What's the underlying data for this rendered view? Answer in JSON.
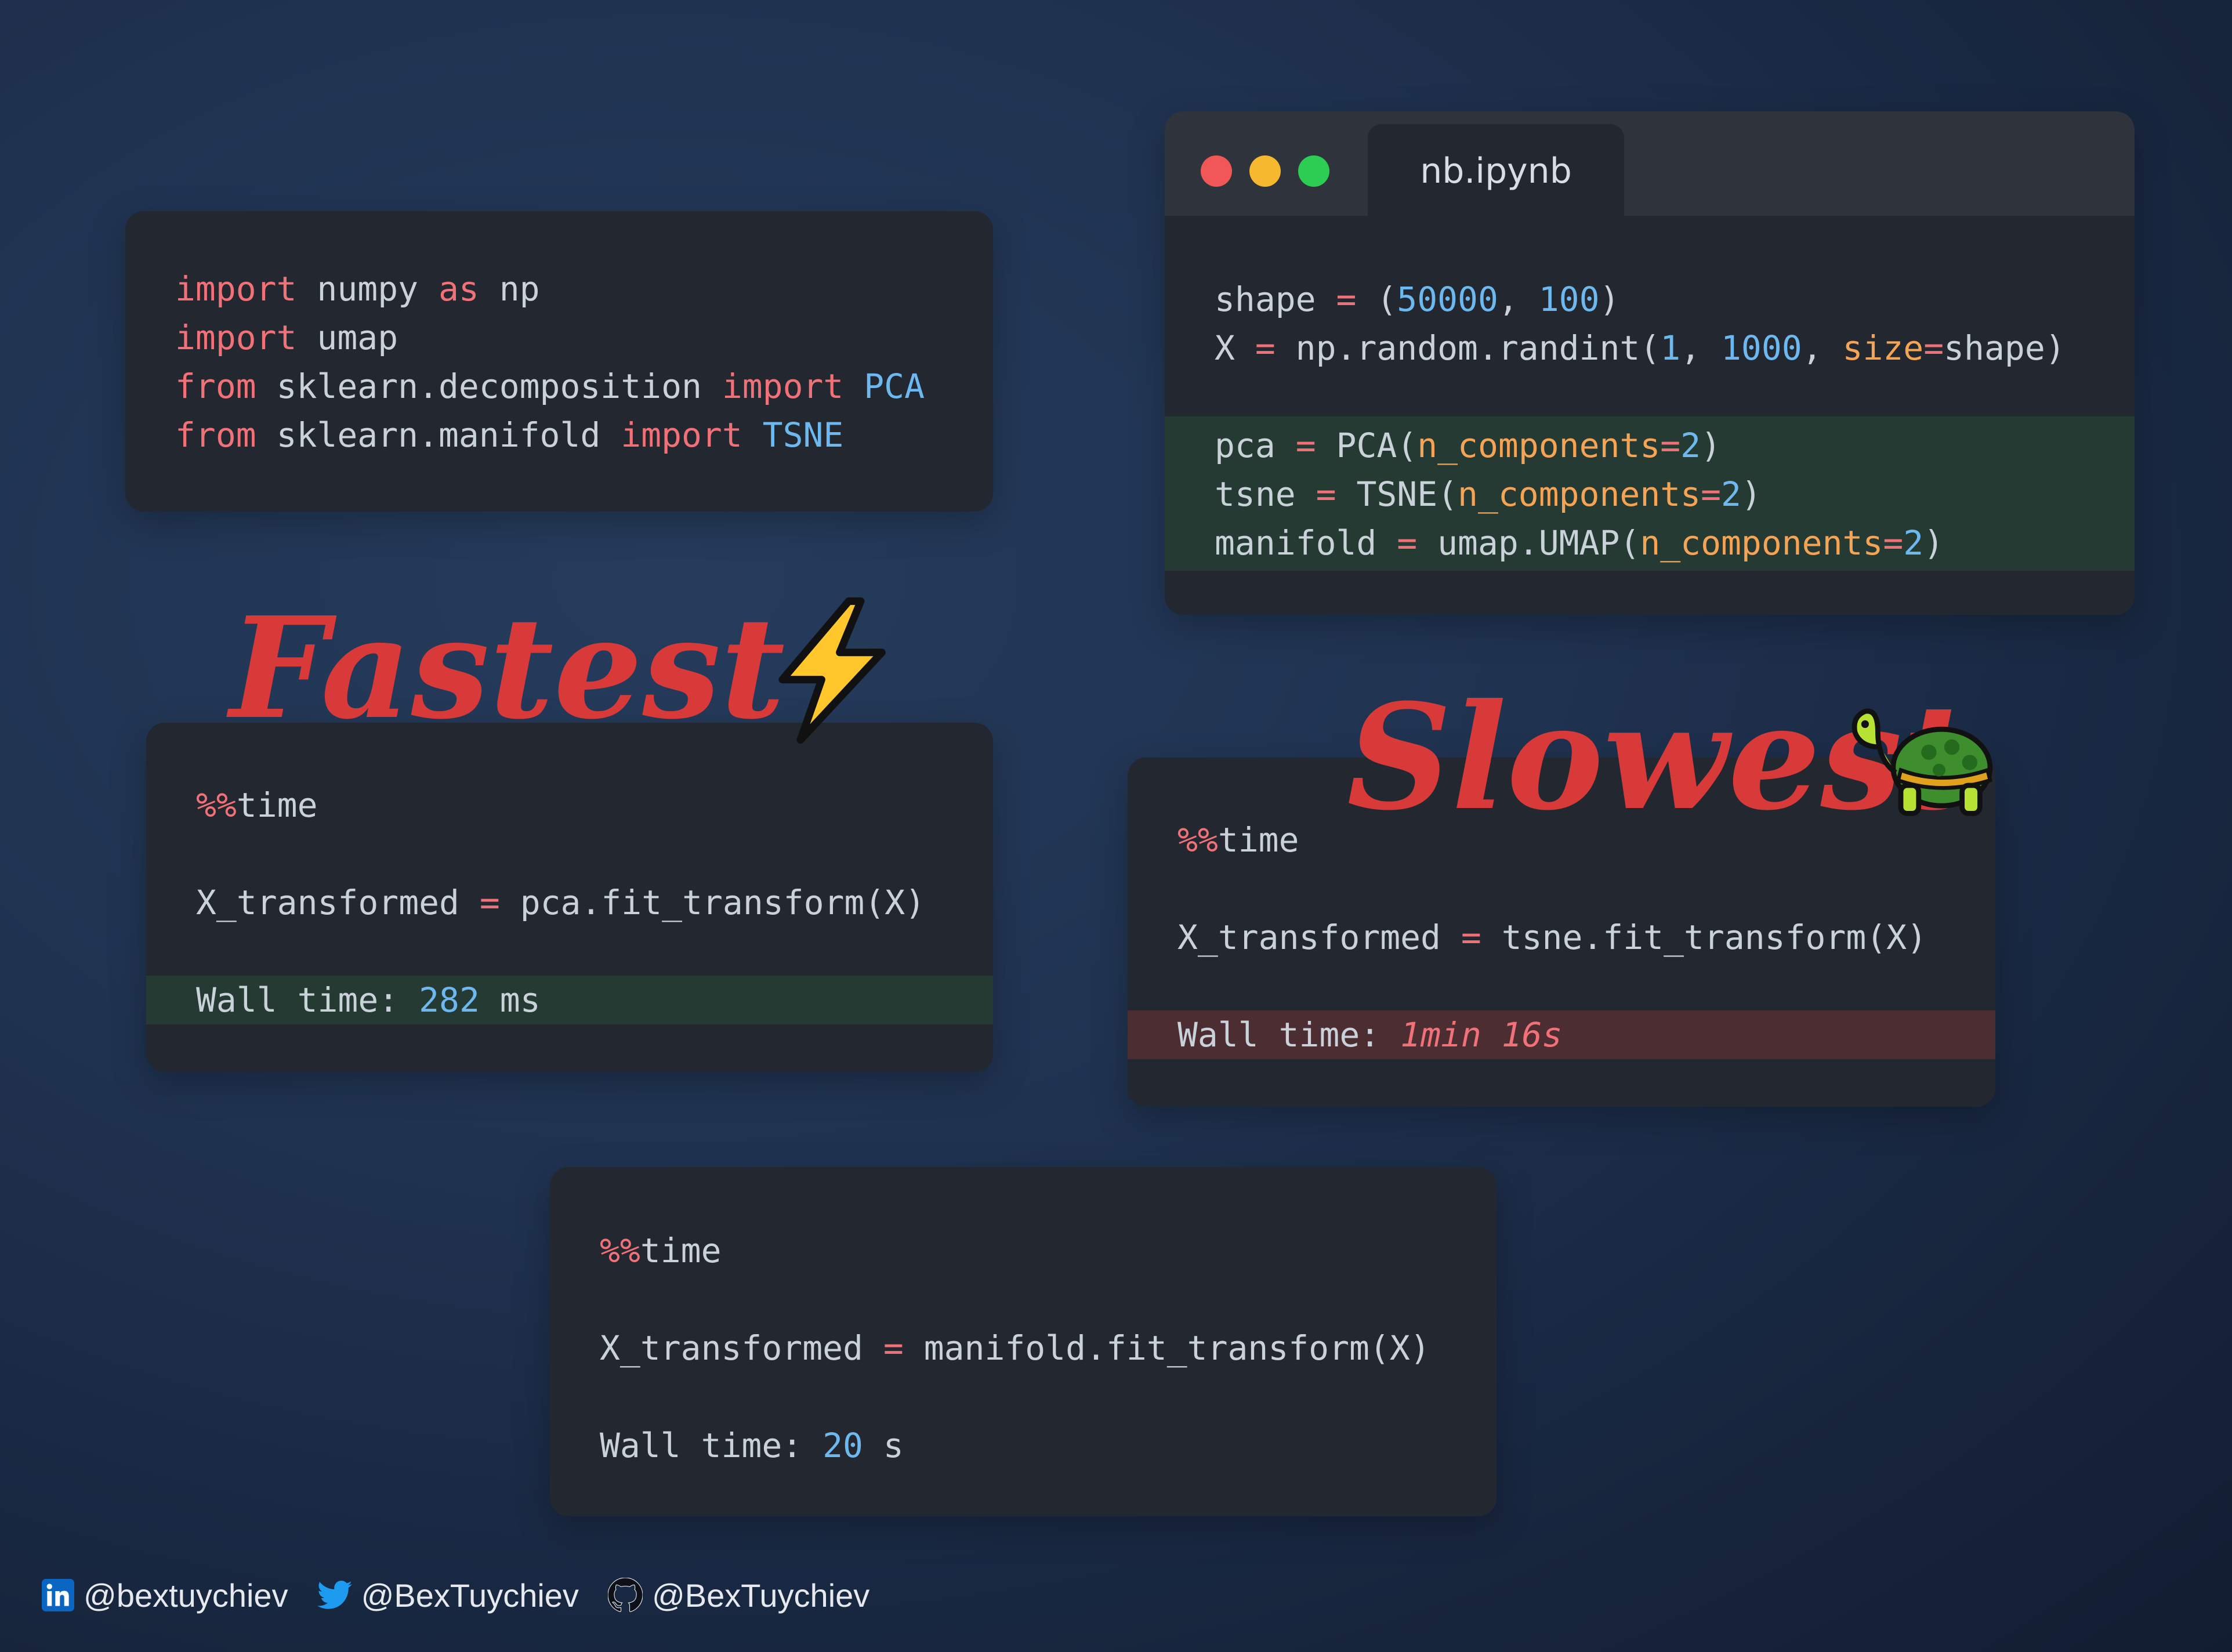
{
  "imports_card": {
    "lines": [
      [
        {
          "t": "import",
          "c": "kw"
        },
        {
          "t": " numpy ",
          "c": ""
        },
        {
          "t": "as",
          "c": "kw"
        },
        {
          "t": " np",
          "c": ""
        }
      ],
      [
        {
          "t": "import",
          "c": "kw"
        },
        {
          "t": " umap",
          "c": ""
        }
      ],
      [
        {
          "t": "from",
          "c": "kw"
        },
        {
          "t": " sklearn.decomposition ",
          "c": ""
        },
        {
          "t": "import",
          "c": "kw"
        },
        {
          "t": " ",
          "c": ""
        },
        {
          "t": "PCA",
          "c": "cls"
        }
      ],
      [
        {
          "t": "from",
          "c": "kw"
        },
        {
          "t": " sklearn.manifold ",
          "c": ""
        },
        {
          "t": "import",
          "c": "kw"
        },
        {
          "t": " ",
          "c": ""
        },
        {
          "t": "TSNE",
          "c": "cls"
        }
      ]
    ]
  },
  "notebook": {
    "tab_label": "nb.ipynb",
    "traffic_colors": [
      "#f25757",
      "#f5b82e",
      "#2dcc52"
    ],
    "lines": [
      [
        {
          "t": "shape ",
          "c": ""
        },
        {
          "t": "=",
          "c": "op"
        },
        {
          "t": " (",
          "c": ""
        },
        {
          "t": "50000",
          "c": "num"
        },
        {
          "t": ", ",
          "c": ""
        },
        {
          "t": "100",
          "c": "num"
        },
        {
          "t": ")",
          "c": ""
        }
      ],
      [
        {
          "t": "X ",
          "c": ""
        },
        {
          "t": "=",
          "c": "op"
        },
        {
          "t": " np.random.randint(",
          "c": ""
        },
        {
          "t": "1",
          "c": "num"
        },
        {
          "t": ", ",
          "c": ""
        },
        {
          "t": "1000",
          "c": "num"
        },
        {
          "t": ", ",
          "c": ""
        },
        {
          "t": "size",
          "c": "arg"
        },
        {
          "t": "=",
          "c": "op"
        },
        {
          "t": "shape)",
          "c": ""
        }
      ],
      [
        {
          "t": "pca ",
          "c": ""
        },
        {
          "t": "=",
          "c": "op"
        },
        {
          "t": " PCA(",
          "c": ""
        },
        {
          "t": "n_components",
          "c": "arg"
        },
        {
          "t": "=",
          "c": "op"
        },
        {
          "t": "2",
          "c": "num"
        },
        {
          "t": ")",
          "c": ""
        }
      ],
      [
        {
          "t": "tsne ",
          "c": ""
        },
        {
          "t": "=",
          "c": "op"
        },
        {
          "t": " TSNE(",
          "c": ""
        },
        {
          "t": "n_components",
          "c": "arg"
        },
        {
          "t": "=",
          "c": "op"
        },
        {
          "t": "2",
          "c": "num"
        },
        {
          "t": ")",
          "c": ""
        }
      ],
      [
        {
          "t": "manifold ",
          "c": ""
        },
        {
          "t": "=",
          "c": "op"
        },
        {
          "t": " umap.UMAP(",
          "c": ""
        },
        {
          "t": "n_components",
          "c": "arg"
        },
        {
          "t": "=",
          "c": "op"
        },
        {
          "t": "2",
          "c": "num"
        },
        {
          "t": ")",
          "c": ""
        }
      ]
    ]
  },
  "labels": {
    "fastest": "Fastest",
    "slowest": "Slowest"
  },
  "pca_card": {
    "lines": [
      [
        {
          "t": "%%",
          "c": "mag"
        },
        {
          "t": "time",
          "c": ""
        }
      ],
      [
        {
          "t": "X_transformed ",
          "c": ""
        },
        {
          "t": "=",
          "c": "op"
        },
        {
          "t": " pca.fit_transform(X)",
          "c": ""
        }
      ],
      [
        {
          "t": "Wall time: ",
          "c": ""
        },
        {
          "t": "282",
          "c": "num"
        },
        {
          "t": " ms",
          "c": ""
        }
      ]
    ]
  },
  "tsne_card": {
    "lines": [
      [
        {
          "t": "%%",
          "c": "mag"
        },
        {
          "t": "time",
          "c": ""
        }
      ],
      [
        {
          "t": "X_transformed ",
          "c": ""
        },
        {
          "t": "=",
          "c": "op"
        },
        {
          "t": " tsne.fit_transform(X)",
          "c": ""
        }
      ],
      [
        {
          "t": "Wall time: ",
          "c": ""
        },
        {
          "t": "1min 16s",
          "c": "red-italic"
        }
      ]
    ]
  },
  "umap_card": {
    "lines": [
      [
        {
          "t": "%%",
          "c": "mag"
        },
        {
          "t": "time",
          "c": ""
        }
      ],
      [
        {
          "t": "X_transformed ",
          "c": ""
        },
        {
          "t": "=",
          "c": "op"
        },
        {
          "t": " manifold.fit_transform(X)",
          "c": ""
        }
      ],
      [
        {
          "t": "Wall time: ",
          "c": ""
        },
        {
          "t": "20",
          "c": "num"
        },
        {
          "t": " s",
          "c": ""
        }
      ]
    ]
  },
  "footer": {
    "linkedin": "@bextuychiev",
    "twitter": "@BexTuychiev",
    "github": "@BexTuychiev"
  }
}
